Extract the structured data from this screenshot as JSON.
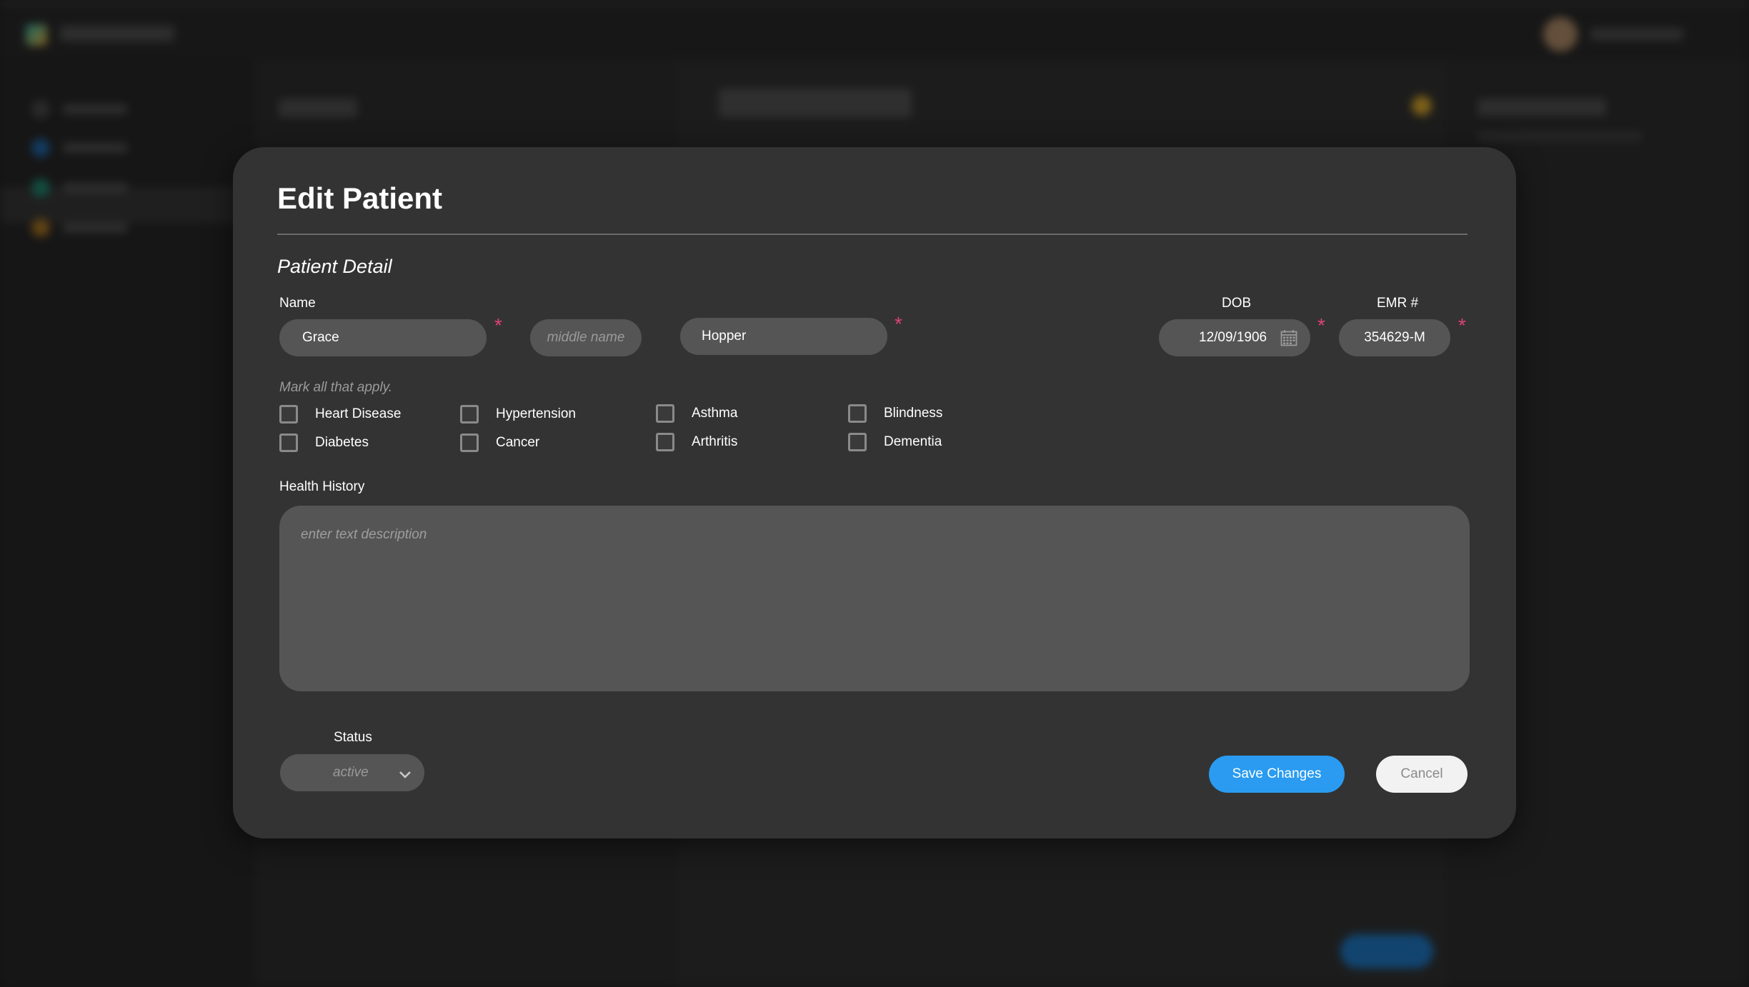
{
  "modal": {
    "title": "Edit Patient",
    "section_title": "Patient Detail",
    "required_mark": "*"
  },
  "name": {
    "label": "Name",
    "first": "Grace",
    "middle_placeholder": "middle name",
    "last": "Hopper"
  },
  "dob": {
    "label": "DOB",
    "value": "12/09/1906"
  },
  "emr": {
    "label": "EMR #",
    "value": "354629-M"
  },
  "conditions": {
    "hint": "Mark all that apply.",
    "items": [
      {
        "label": "Heart Disease",
        "checked": false
      },
      {
        "label": "Hypertension",
        "checked": false
      },
      {
        "label": "Asthma",
        "checked": false
      },
      {
        "label": "Blindness",
        "checked": false
      },
      {
        "label": "Diabetes",
        "checked": false
      },
      {
        "label": "Cancer",
        "checked": false
      },
      {
        "label": "Arthritis",
        "checked": false
      },
      {
        "label": "Dementia",
        "checked": false
      }
    ]
  },
  "health_history": {
    "label": "Health History",
    "placeholder": "enter text description"
  },
  "status": {
    "label": "Status",
    "value": "active"
  },
  "actions": {
    "save_label": "Save Changes",
    "cancel_label": "Cancel"
  },
  "colors": {
    "accent": "#2a9bf0",
    "required": "#e0417a",
    "modal_bg": "#333333",
    "field_bg": "#555555"
  }
}
